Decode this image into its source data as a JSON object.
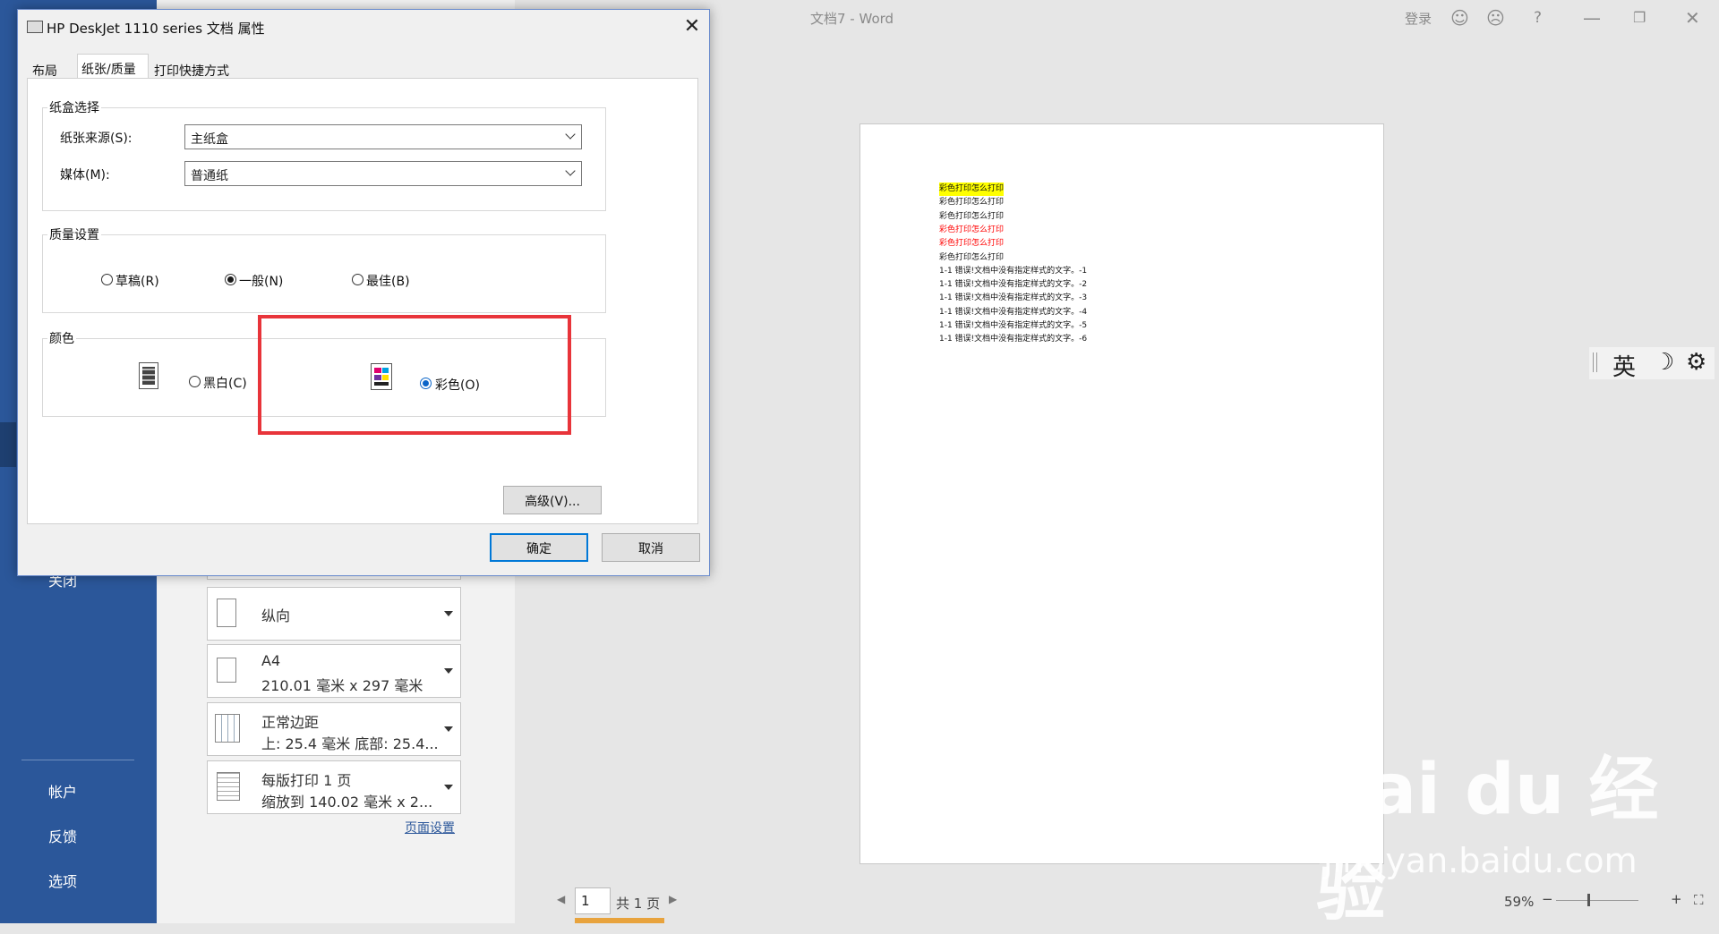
{
  "app": {
    "window_title": "文档7  -  Word",
    "login": "登录"
  },
  "sidebar": {
    "items": [
      "关闭",
      "帐户",
      "反馈",
      "选项"
    ]
  },
  "print_settings": {
    "orientation": "纵向",
    "paper": {
      "name": "A4",
      "size": "210.01 毫米 x 297 毫米"
    },
    "margins": {
      "name": "正常边距",
      "detail": "上: 25.4 毫米 底部: 25.4..."
    },
    "pages_per_sheet": {
      "name": "每版打印 1 页",
      "detail": "缩放到 140.02 毫米 x 2..."
    },
    "page_setup_link": "页面设置"
  },
  "document": {
    "lines": [
      {
        "text": "彩色打印怎么打印",
        "color": "#111111",
        "highlight": "#ffff00"
      },
      {
        "text": "彩色打印怎么打印",
        "color": "#111111"
      },
      {
        "text": "彩色打印怎么打印",
        "color": "#111111"
      },
      {
        "text": "彩色打印怎么打印",
        "color": "#ff0000"
      },
      {
        "text": "彩色打印怎么打印",
        "color": "#ff0000"
      },
      {
        "text": "彩色打印怎么打印",
        "color": "#111111"
      },
      {
        "text": "1-1 错误!文档中没有指定样式的文字。-1",
        "color": "#111111"
      },
      {
        "text": "1-1 错误!文档中没有指定样式的文字。-2",
        "color": "#111111"
      },
      {
        "text": "1-1 错误!文档中没有指定样式的文字。-3",
        "color": "#111111"
      },
      {
        "text": "1-1 错误!文档中没有指定样式的文字。-4",
        "color": "#111111"
      },
      {
        "text": "1-1 错误!文档中没有指定样式的文字。-5",
        "color": "#111111"
      },
      {
        "text": "1-1 错误!文档中没有指定样式的文字。-6",
        "color": "#111111"
      }
    ]
  },
  "ime": {
    "lang": "英"
  },
  "status": {
    "page_input": "1",
    "page_total": "共 1 页",
    "zoom": "59%",
    "zoom_level": 0.59
  },
  "dialog": {
    "title": "HP DeskJet 1110 series 文档 属性",
    "tabs": [
      "布局",
      "纸张/质量",
      "打印快捷方式"
    ],
    "active_tab": 1,
    "tray_group": "纸盒选择",
    "source_label": "纸张来源(S):",
    "source_value": "主纸盒",
    "media_label": "媒体(M):",
    "media_value": "普通纸",
    "quality_group": "质量设置",
    "quality_options": [
      "草稿(R)",
      "一般(N)",
      "最佳(B)"
    ],
    "quality_selected": "一般(N)",
    "color_group": "颜色",
    "color_options": [
      "黑白(C)",
      "彩色(O)"
    ],
    "color_selected": "彩色(O)",
    "advanced_button": "高级(V)...",
    "ok_button": "确定",
    "cancel_button": "取消"
  },
  "watermark": {
    "logo": "Bai du 经验",
    "url": "jingyan.baidu.com"
  },
  "colors": {
    "accent": "#2b579a",
    "highlight_box": "#e8343a",
    "radio_selected": "#0a64c8"
  }
}
